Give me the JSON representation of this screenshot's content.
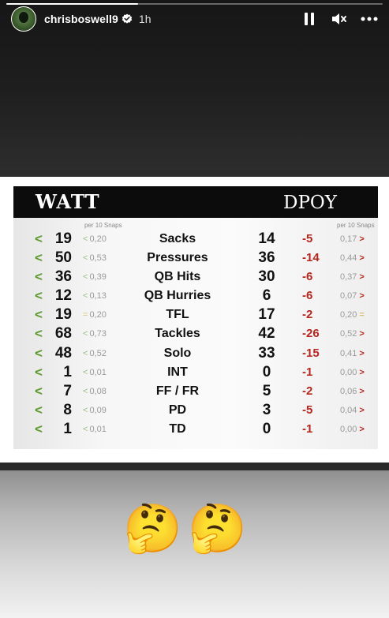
{
  "story": {
    "username": "chrisboswell9",
    "time_ago": "1h",
    "progress": 0.35,
    "icons": {
      "verified": "verified-badge-icon",
      "pause": "pause-icon",
      "mute": "mute-icon",
      "more": "more-icon"
    }
  },
  "card": {
    "left_title": "WATT",
    "right_title": "DPOY",
    "left_sub": "per 10 Snaps",
    "right_sub": "per 10 Snaps",
    "rows": [
      {
        "arrow": "<",
        "watt": "19",
        "watt_sym": "<",
        "watt_rate": "0,20",
        "label": "Sacks",
        "dpoy": "14",
        "diff": "-5",
        "dpoy_rate": "0,17",
        "dpoy_sym": ">"
      },
      {
        "arrow": "<",
        "watt": "50",
        "watt_sym": "<",
        "watt_rate": "0,53",
        "label": "Pressures",
        "dpoy": "36",
        "diff": "-14",
        "dpoy_rate": "0,44",
        "dpoy_sym": ">"
      },
      {
        "arrow": "<",
        "watt": "36",
        "watt_sym": "<",
        "watt_rate": "0,39",
        "label": "QB Hits",
        "dpoy": "30",
        "diff": "-6",
        "dpoy_rate": "0,37",
        "dpoy_sym": ">"
      },
      {
        "arrow": "<",
        "watt": "12",
        "watt_sym": "<",
        "watt_rate": "0,13",
        "label": "QB Hurries",
        "dpoy": "6",
        "diff": "-6",
        "dpoy_rate": "0,07",
        "dpoy_sym": ">"
      },
      {
        "arrow": "<",
        "watt": "19",
        "watt_sym": "=",
        "watt_rate": "0,20",
        "label": "TFL",
        "dpoy": "17",
        "diff": "-2",
        "dpoy_rate": "0,20",
        "dpoy_sym": "="
      },
      {
        "arrow": "<",
        "watt": "68",
        "watt_sym": "<",
        "watt_rate": "0,73",
        "label": "Tackles",
        "dpoy": "42",
        "diff": "-26",
        "dpoy_rate": "0,52",
        "dpoy_sym": ">"
      },
      {
        "arrow": "<",
        "watt": "48",
        "watt_sym": "<",
        "watt_rate": "0,52",
        "label": "Solo",
        "dpoy": "33",
        "diff": "-15",
        "dpoy_rate": "0,41",
        "dpoy_sym": ">"
      },
      {
        "arrow": "<",
        "watt": "1",
        "watt_sym": "<",
        "watt_rate": "0,01",
        "label": "INT",
        "dpoy": "0",
        "diff": "-1",
        "dpoy_rate": "0,00",
        "dpoy_sym": ">"
      },
      {
        "arrow": "<",
        "watt": "7",
        "watt_sym": "<",
        "watt_rate": "0,08",
        "label": "FF / FR",
        "dpoy": "5",
        "diff": "-2",
        "dpoy_rate": "0,06",
        "dpoy_sym": ">"
      },
      {
        "arrow": "<",
        "watt": "8",
        "watt_sym": "<",
        "watt_rate": "0,09",
        "label": "PD",
        "dpoy": "3",
        "diff": "-5",
        "dpoy_rate": "0,04",
        "dpoy_sym": ">"
      },
      {
        "arrow": "<",
        "watt": "1",
        "watt_sym": "<",
        "watt_rate": "0,01",
        "label": "TD",
        "dpoy": "0",
        "diff": "-1",
        "dpoy_rate": "0,00",
        "dpoy_sym": ">"
      }
    ]
  },
  "emojis": [
    {
      "icon": "thinking-face-emoji",
      "glyph": "🤔"
    },
    {
      "icon": "thinking-face-emoji",
      "glyph": "🤔"
    }
  ]
}
